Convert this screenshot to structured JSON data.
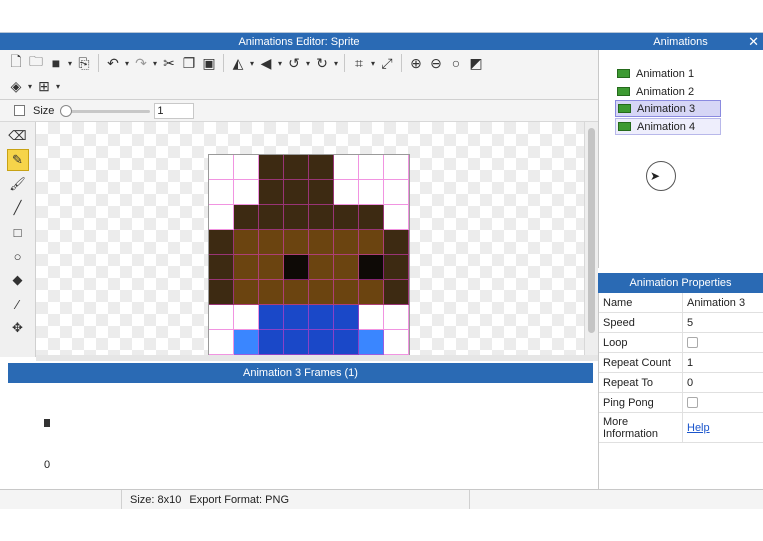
{
  "window": {
    "title": "Animations Editor: Sprite",
    "close_glyph": "✕"
  },
  "toolbar": {
    "row1": [
      "new-file-icon",
      "open-folder-icon",
      "save-icon",
      "export-icon",
      "undo-icon",
      "redo-icon",
      "cut-icon",
      "copy-icon",
      "paste-icon",
      "flip-horizontal-icon",
      "flip-vertical-icon",
      "rotate-left-icon",
      "rotate-right-icon",
      "crop-icon",
      "resize-icon",
      "zoom-in-icon",
      "zoom-out-icon",
      "zoom-reset-icon",
      "invert-icon"
    ],
    "row2": [
      "layers-icon",
      "grid-icon"
    ]
  },
  "sizebar": {
    "label": "Size",
    "value": "1"
  },
  "tools": [
    "eraser-icon",
    "pencil-icon",
    "brush-icon",
    "line-icon",
    "rectangle-icon",
    "ellipse-icon",
    "fill-icon",
    "eyedropper-icon",
    "move-icon"
  ],
  "active_tool": "pencil-icon",
  "sprite": {
    "cols": 8,
    "rows": 10,
    "palette": {
      "0": "#ffffff",
      "1": "#3d2a12",
      "2": "#6b4410",
      "3": "#0e0a06",
      "4": "#1a48c8",
      "5": "#3a86ff"
    },
    "pixels": [
      "00111000",
      "00111000",
      "01111110",
      "12222221",
      "12232231",
      "12222221",
      "00444400",
      "05444450",
      "05444450",
      "05444450"
    ]
  },
  "frames_panel": {
    "title": "Animation 3 Frames (1)",
    "frame_index": "0"
  },
  "animations_panel": {
    "title": "Animations",
    "items": [
      "Animation 1",
      "Animation 2",
      "Animation 3",
      "Animation 4"
    ],
    "selected": "Animation 3",
    "hovered": "Animation 4"
  },
  "properties_panel": {
    "title": "Animation Properties",
    "rows": [
      {
        "key": "Name",
        "value": "Animation 3",
        "kind": "text"
      },
      {
        "key": "Speed",
        "value": "5",
        "kind": "text"
      },
      {
        "key": "Loop",
        "value": "",
        "kind": "checkbox"
      },
      {
        "key": "Repeat Count",
        "value": "1",
        "kind": "text"
      },
      {
        "key": "Repeat To",
        "value": "0",
        "kind": "text"
      },
      {
        "key": "Ping Pong",
        "value": "",
        "kind": "checkbox"
      },
      {
        "key": "More Information",
        "value": "Help",
        "kind": "link"
      }
    ]
  },
  "status": {
    "size": "Size: 8x10",
    "export_format": "Export Format: PNG"
  }
}
